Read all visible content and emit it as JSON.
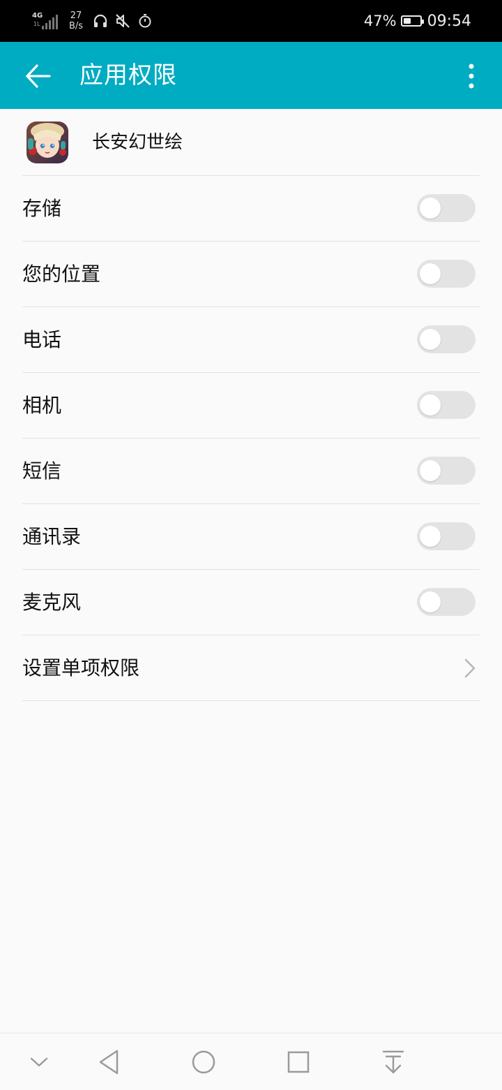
{
  "status_bar": {
    "network_type": "4G",
    "network_sub": "1L",
    "speed_value": "27",
    "speed_unit": "B/s",
    "icons": [
      "headphones-icon",
      "mute-icon",
      "alarm-icon"
    ],
    "battery_percent": "47%",
    "battery_level": 0.47,
    "time": "09:54"
  },
  "app_bar": {
    "title": "应用权限",
    "background_color": "#00acc1",
    "back_icon": "arrow-left-icon",
    "menu_icon": "more-vertical-icon"
  },
  "app": {
    "name": "长安幻世绘",
    "icon": "app-icon"
  },
  "permissions": [
    {
      "label": "存储",
      "enabled": false
    },
    {
      "label": "您的位置",
      "enabled": false
    },
    {
      "label": "电话",
      "enabled": false
    },
    {
      "label": "相机",
      "enabled": false
    },
    {
      "label": "短信",
      "enabled": false
    },
    {
      "label": "通讯录",
      "enabled": false
    },
    {
      "label": "麦克风",
      "enabled": false
    }
  ],
  "individual_permissions": {
    "label": "设置单项权限",
    "icon": "chevron-right-icon"
  },
  "nav_bar": {
    "buttons": [
      "collapse-icon",
      "back-icon",
      "home-icon",
      "recents-icon",
      "notifications-pull-icon"
    ]
  }
}
